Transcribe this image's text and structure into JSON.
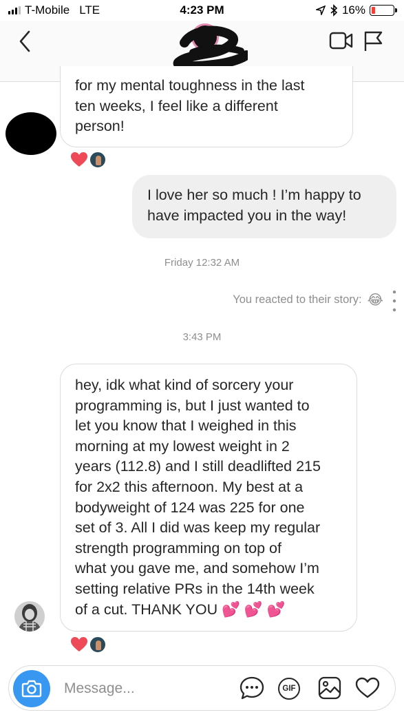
{
  "status_bar": {
    "carrier": "T-Mobile",
    "network": "LTE",
    "time": "4:23 PM",
    "battery_percent": "16%",
    "battery_level": 0.16
  },
  "header": {
    "back_icon": "chevron-left-icon",
    "video_icon": "video-camera-icon",
    "flag_icon": "flag-icon"
  },
  "thread": {
    "msg1_lines": [
      "for my mental toughness in the last",
      "ten weeks, I feel like a different",
      "person!"
    ],
    "msg2_lines": [
      "I love her so much ! I’m happy to",
      "have impacted you in the way!"
    ],
    "timestamp1": "Friday 12:32 AM",
    "story_reaction": "You reacted to their story:",
    "story_emoji": "😂",
    "timestamp2": "3:43 PM",
    "msg3_lines": [
      "hey, idk what kind of sorcery your",
      "programming is, but I just wanted to",
      "let you know that I weighed in this",
      "morning at my lowest weight in 2",
      "years (112.8) and I still deadlifted 215",
      "for 2x2 this afternoon. My best at a",
      "bodyweight of 124 was 225 for one",
      "set of 3. All I did was keep my regular",
      "strength programming on top of",
      "what you gave me, and somehow I’m",
      "setting relative PRs in the 14th week",
      "of a cut. THANK YOU 💕 💕 💕"
    ],
    "reaction_emoji": "❤️"
  },
  "composer": {
    "placeholder": "Message...",
    "gif_label": "GIF"
  },
  "colors": {
    "accent": "#3897f0",
    "outgoing_bubble": "#efefef",
    "heart": "#ed4956",
    "battery_low": "#ff3b30"
  }
}
